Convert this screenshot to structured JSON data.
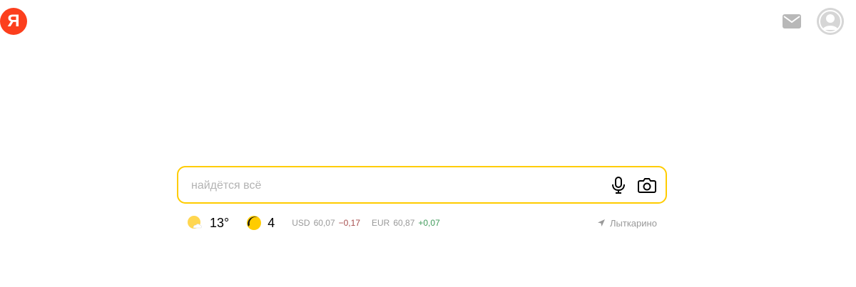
{
  "header": {
    "logo_letter": "Я"
  },
  "search": {
    "placeholder": "найдётся всё",
    "value": ""
  },
  "weather": {
    "temperature": "13°"
  },
  "traffic": {
    "level": "4"
  },
  "rates": [
    {
      "currency": "USD",
      "value": "60,07",
      "change": "−0,17"
    },
    {
      "currency": "EUR",
      "value": "60,87",
      "change": "+0,07"
    }
  ],
  "region": {
    "name": "Лыткарино"
  },
  "colors": {
    "brand": "#fc3f1d",
    "search_border": "#ffcc00",
    "negative_change": "#a64d4d",
    "positive_change": "#3f9a5a"
  }
}
